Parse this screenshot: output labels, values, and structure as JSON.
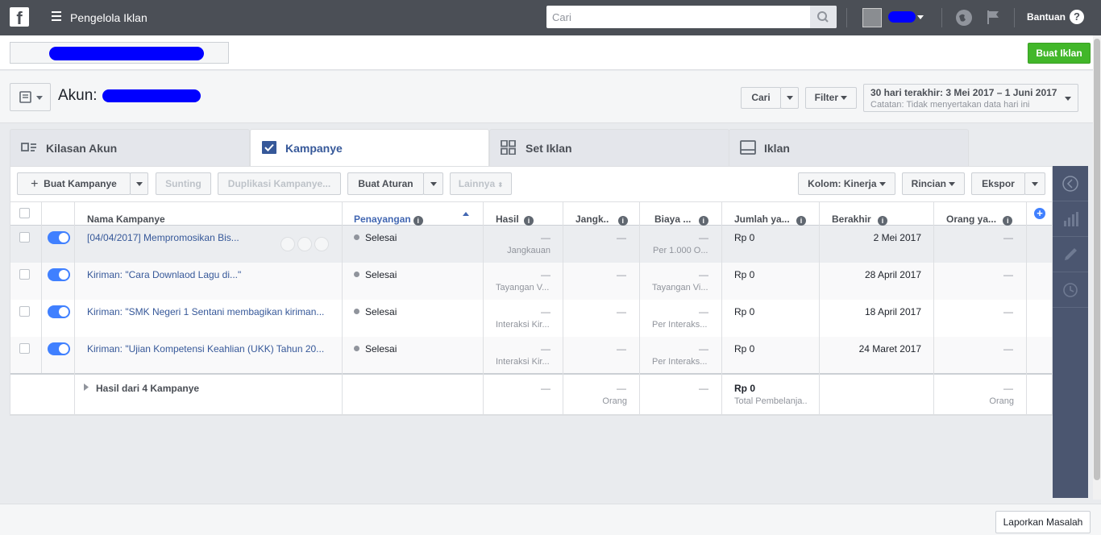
{
  "topbar": {
    "app_title": "Pengelola Iklan",
    "search_placeholder": "Cari",
    "help_label": "Bantuan",
    "help_icon": "?"
  },
  "subbar": {
    "create_ad_label": "Buat Iklan"
  },
  "header": {
    "account_label": "Akun:",
    "search_label": "Cari",
    "filter_label": "Filter",
    "date_range": "30 hari terakhir: 3 Mei 2017 – 1 Juni 2017",
    "date_note": "Catatan: Tidak menyertakan data hari ini"
  },
  "tabs": [
    {
      "label": "Kilasan Akun",
      "icon": "overview-icon"
    },
    {
      "label": "Kampanye",
      "icon": "checkbox-icon"
    },
    {
      "label": "Set Iklan",
      "icon": "grid-icon"
    },
    {
      "label": "Iklan",
      "icon": "ad-icon"
    }
  ],
  "toolbar": {
    "create_label": "Buat Kampanye",
    "edit_label": "Sunting",
    "duplicate_label": "Duplikasi Kampanye...",
    "rule_label": "Buat Aturan",
    "more_label": "Lainnya",
    "columns_label": "Kolom: Kinerja",
    "breakdown_label": "Rincian",
    "export_label": "Ekspor"
  },
  "table": {
    "headers": {
      "name": "Nama Kampanye",
      "delivery": "Penayangan",
      "results": "Hasil",
      "reach": "Jangk..",
      "cost": "Biaya ...",
      "spent": "Jumlah ya...",
      "ends": "Berakhir",
      "people": "Orang ya..."
    },
    "rows": [
      {
        "name": "[04/04/2017] Mempromosikan Bis...",
        "status": "Selesai",
        "results": "—",
        "results_sub": "Jangkauan",
        "reach": "—",
        "cost": "—",
        "cost_sub": "Per 1.000 O...",
        "spent": "Rp 0",
        "ends": "2 Mei 2017",
        "people": "—"
      },
      {
        "name": "Kiriman: \"Cara Downlaod Lagu di...\"",
        "status": "Selesai",
        "results": "—",
        "results_sub": "Tayangan V...",
        "reach": "—",
        "cost": "—",
        "cost_sub": "Tayangan Vi...",
        "spent": "Rp 0",
        "ends": "28 April 2017",
        "people": "—"
      },
      {
        "name": "Kiriman: \"SMK Negeri 1 Sentani membagikan kiriman...",
        "status": "Selesai",
        "results": "—",
        "results_sub": "Interaksi Kir...",
        "reach": "—",
        "cost": "—",
        "cost_sub": "Per Interaks...",
        "spent": "Rp 0",
        "ends": "18 April 2017",
        "people": "—"
      },
      {
        "name": "Kiriman: \"Ujian Kompetensi Keahlian (UKK) Tahun 20...",
        "status": "Selesai",
        "results": "—",
        "results_sub": "Interaksi Kir...",
        "reach": "—",
        "cost": "—",
        "cost_sub": "Per Interaks...",
        "spent": "Rp 0",
        "ends": "24 Maret 2017",
        "people": "—"
      }
    ],
    "summary": {
      "label": "Hasil dari 4 Kampanye",
      "results": "—",
      "reach": "—",
      "reach_sub": "Orang",
      "cost": "—",
      "spent": "Rp 0",
      "spent_sub": "Total Pembelanja..",
      "people": "—",
      "people_sub": "Orang"
    }
  },
  "footer": {
    "report_label": "Laporkan Masalah"
  },
  "colors": {
    "topbar": "#4b4f56",
    "link": "#365899",
    "green": "#42b72a",
    "toggle": "#4080ff",
    "side_panel": "#4b5670"
  }
}
